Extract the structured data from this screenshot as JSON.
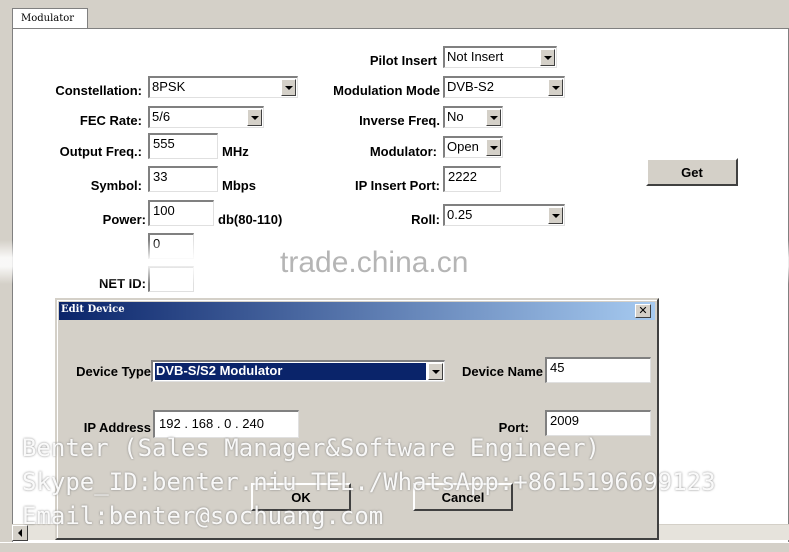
{
  "tab": {
    "label": "Modulator"
  },
  "form": {
    "constellation": {
      "label": "Constellation:",
      "value": "8PSK"
    },
    "fec_rate": {
      "label": "FEC Rate:",
      "value": "5/6"
    },
    "output_freq": {
      "label": "Output Freq.:",
      "value": "555",
      "unit": "MHz"
    },
    "symbol": {
      "label": "Symbol:",
      "value": "33",
      "unit": "Mbps"
    },
    "power": {
      "label": "Power:",
      "value": "100",
      "unit": "db(80-110)"
    },
    "hidden_field": {
      "value": "0"
    },
    "net_id": {
      "label": "NET ID:"
    },
    "pilot_insert": {
      "label": "Pilot Insert",
      "value": "Not Insert"
    },
    "modulation_mode": {
      "label": "Modulation Mode",
      "value": "DVB-S2"
    },
    "inverse_freq": {
      "label": "Inverse Freq.",
      "value": "No"
    },
    "modulator": {
      "label": "Modulator:",
      "value": "Open"
    },
    "ip_insert_port": {
      "label": "IP Insert Port:",
      "value": "2222"
    },
    "roll": {
      "label": "Roll:",
      "value": "0.25"
    },
    "get_label": "Get"
  },
  "watermark": {
    "text": "trade.china.cn"
  },
  "dialog": {
    "title": "Edit Device",
    "close_glyph": "✕",
    "device_type": {
      "label": "Device Type",
      "value": "DVB-S/S2 Modulator"
    },
    "device_name": {
      "label": "Device Name",
      "value": "45"
    },
    "ip_address": {
      "label": "IP Address",
      "octets": [
        "192",
        "168",
        "0",
        "240"
      ],
      "dot": "."
    },
    "port": {
      "label": "Port:",
      "value": "2009"
    },
    "ok_label": "OK",
    "cancel_label": "Cancel"
  },
  "overlay": {
    "line1": "Benter (Sales Manager&Software Engineer)",
    "line2": "Skype_ID:benter.niu  TEL./WhatsApp:+8615196699123",
    "line3": "Email:benter@sochuang.com"
  }
}
